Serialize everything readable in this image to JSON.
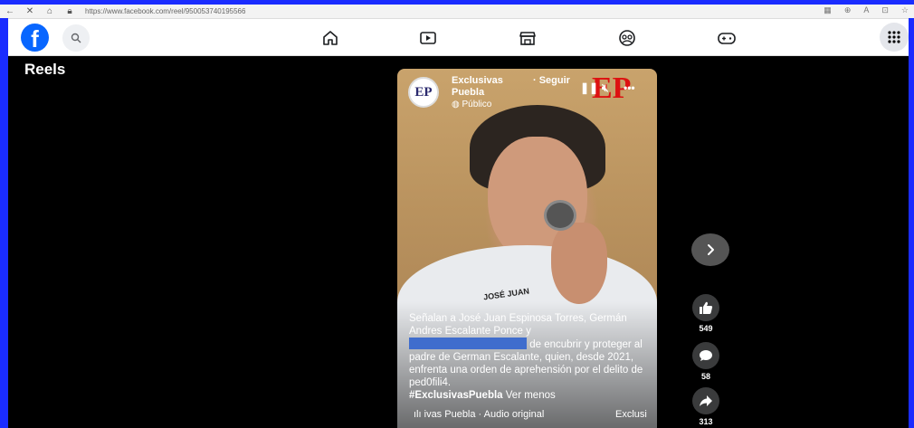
{
  "browser": {
    "url": "https://www.facebook.com/reel/950053740195566"
  },
  "header": {
    "logo_letter": "f",
    "nav_icons": [
      "home-icon",
      "video-icon",
      "marketplace-icon",
      "groups-icon",
      "gaming-icon"
    ]
  },
  "reels": {
    "title": "Reels"
  },
  "video": {
    "page_name": "Exclusivas Puebla",
    "follow_label": "· Seguir",
    "privacy": "Público",
    "avatar_text": "EP",
    "shirt_text": "JOSÉ JUAN",
    "caption_part1": "Señalan a José Juan Espinosa Torres, Germán Andres Escalante Ponce y",
    "caption_part2": "de encubrir y proteger al padre de German Escalante, quien, desde 2021, enfrenta una orden de aprehensión por el delito de ped0fili4.",
    "hashtag": "#ExclusivasPuebla",
    "see_less": "Ver menos",
    "audio_label": "ivas Puebla · Audio original",
    "audio_right": "Exclusi"
  },
  "actions": {
    "likes": "549",
    "comments": "58",
    "shares": "313"
  },
  "colors": {
    "fb_blue": "#0866ff",
    "frame_blue": "#1a2cff",
    "redaction_blue": "#3f6dcd"
  }
}
